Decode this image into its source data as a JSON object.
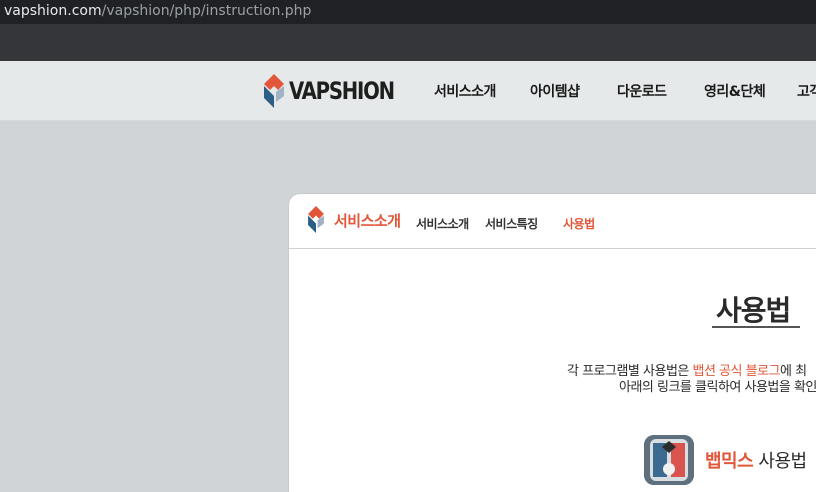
{
  "browser": {
    "url_host": "vapshion.com",
    "url_path": "/vapshion/php/instruction.php"
  },
  "header": {
    "logo_text": "VAPSHION",
    "nav": [
      "서비스소개",
      "아이템샵",
      "다운로드",
      "영리&단체",
      "고객"
    ]
  },
  "subnav": {
    "section_title": "서비스소개",
    "links": [
      "서비스소개",
      "서비스특징",
      "사용법"
    ],
    "active_index": 2
  },
  "content": {
    "title": "사용법",
    "desc_line1_prefix": "각 프로그램별 사용법은 ",
    "desc_line1_highlight": "뱁션 공식 블로그",
    "desc_line1_suffix": "에 최",
    "desc_line2": "아래의 링크를 클릭하여 사용법을 확인",
    "app_name_highlight": "뱁믹스",
    "app_name_rest": " 사용법"
  },
  "colors": {
    "accent": "#e2573a",
    "logo_blue": "#2b5f86"
  }
}
